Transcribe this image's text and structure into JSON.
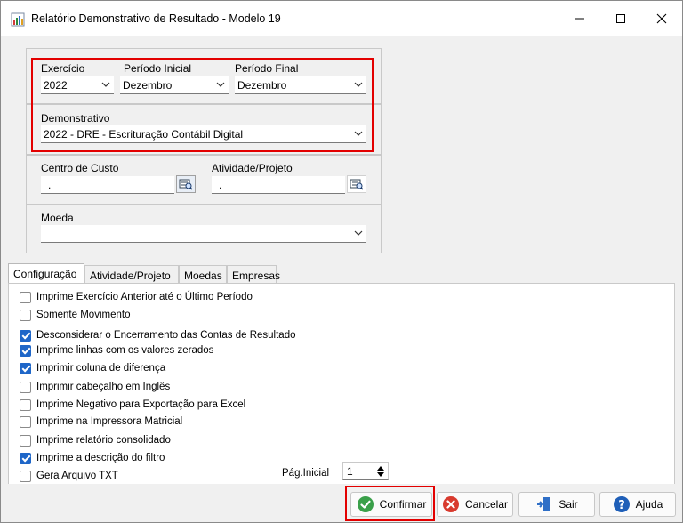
{
  "window": {
    "title": "Relatório Demonstrativo de Resultado - Modelo 19",
    "minimize_icon": "minimize-icon",
    "maximize_icon": "maximize-icon",
    "close_icon": "close-icon"
  },
  "filters": {
    "exercicio": {
      "label": "Exercício",
      "value": "2022"
    },
    "periodo_inicial": {
      "label": "Período Inicial",
      "value": "Dezembro"
    },
    "periodo_final": {
      "label": "Período Final",
      "value": "Dezembro"
    },
    "demonstrativo": {
      "label": "Demonstrativo",
      "value": "2022 - DRE - Escrituração Contábil Digital"
    },
    "centro_custo": {
      "label": "Centro de Custo",
      "value": "."
    },
    "atividade_projeto": {
      "label": "Atividade/Projeto",
      "value": "."
    },
    "moeda": {
      "label": "Moeda",
      "value": ""
    }
  },
  "tabs": [
    {
      "label": "Configuração",
      "active": true
    },
    {
      "label": "Atividade/Projeto",
      "active": false
    },
    {
      "label": "Moedas",
      "active": false
    },
    {
      "label": "Empresas",
      "active": false
    }
  ],
  "options": [
    {
      "label": "Imprime Exercício Anterior até o Último Período",
      "checked": false
    },
    {
      "label": "Somente Movimento",
      "checked": false
    },
    {
      "label": "Desconsiderar o Encerramento das Contas de Resultado",
      "checked": true
    },
    {
      "label": "Imprime linhas com os valores zerados",
      "checked": true
    },
    {
      "label": "Imprimir coluna de diferença",
      "checked": true
    },
    {
      "label": "Imprimir cabeçalho em Inglês",
      "checked": false
    },
    {
      "label": "Imprime Negativo para Exportação para Excel",
      "checked": false
    },
    {
      "label": "Imprime na Impressora Matricial",
      "checked": false
    },
    {
      "label": "Imprime relatório consolidado",
      "checked": false
    },
    {
      "label": "Imprime a descrição do filtro",
      "checked": true
    },
    {
      "label": "Gera Arquivo TXT",
      "checked": false
    }
  ],
  "pagina_inicial": {
    "label": "Pág.Inicial",
    "value": "1"
  },
  "buttons": {
    "confirmar": "Confirmar",
    "cancelar": "Cancelar",
    "sair": "Sair",
    "ajuda": "Ajuda"
  },
  "colors": {
    "highlight": "#e30000",
    "check_accent": "#1e66c8"
  }
}
